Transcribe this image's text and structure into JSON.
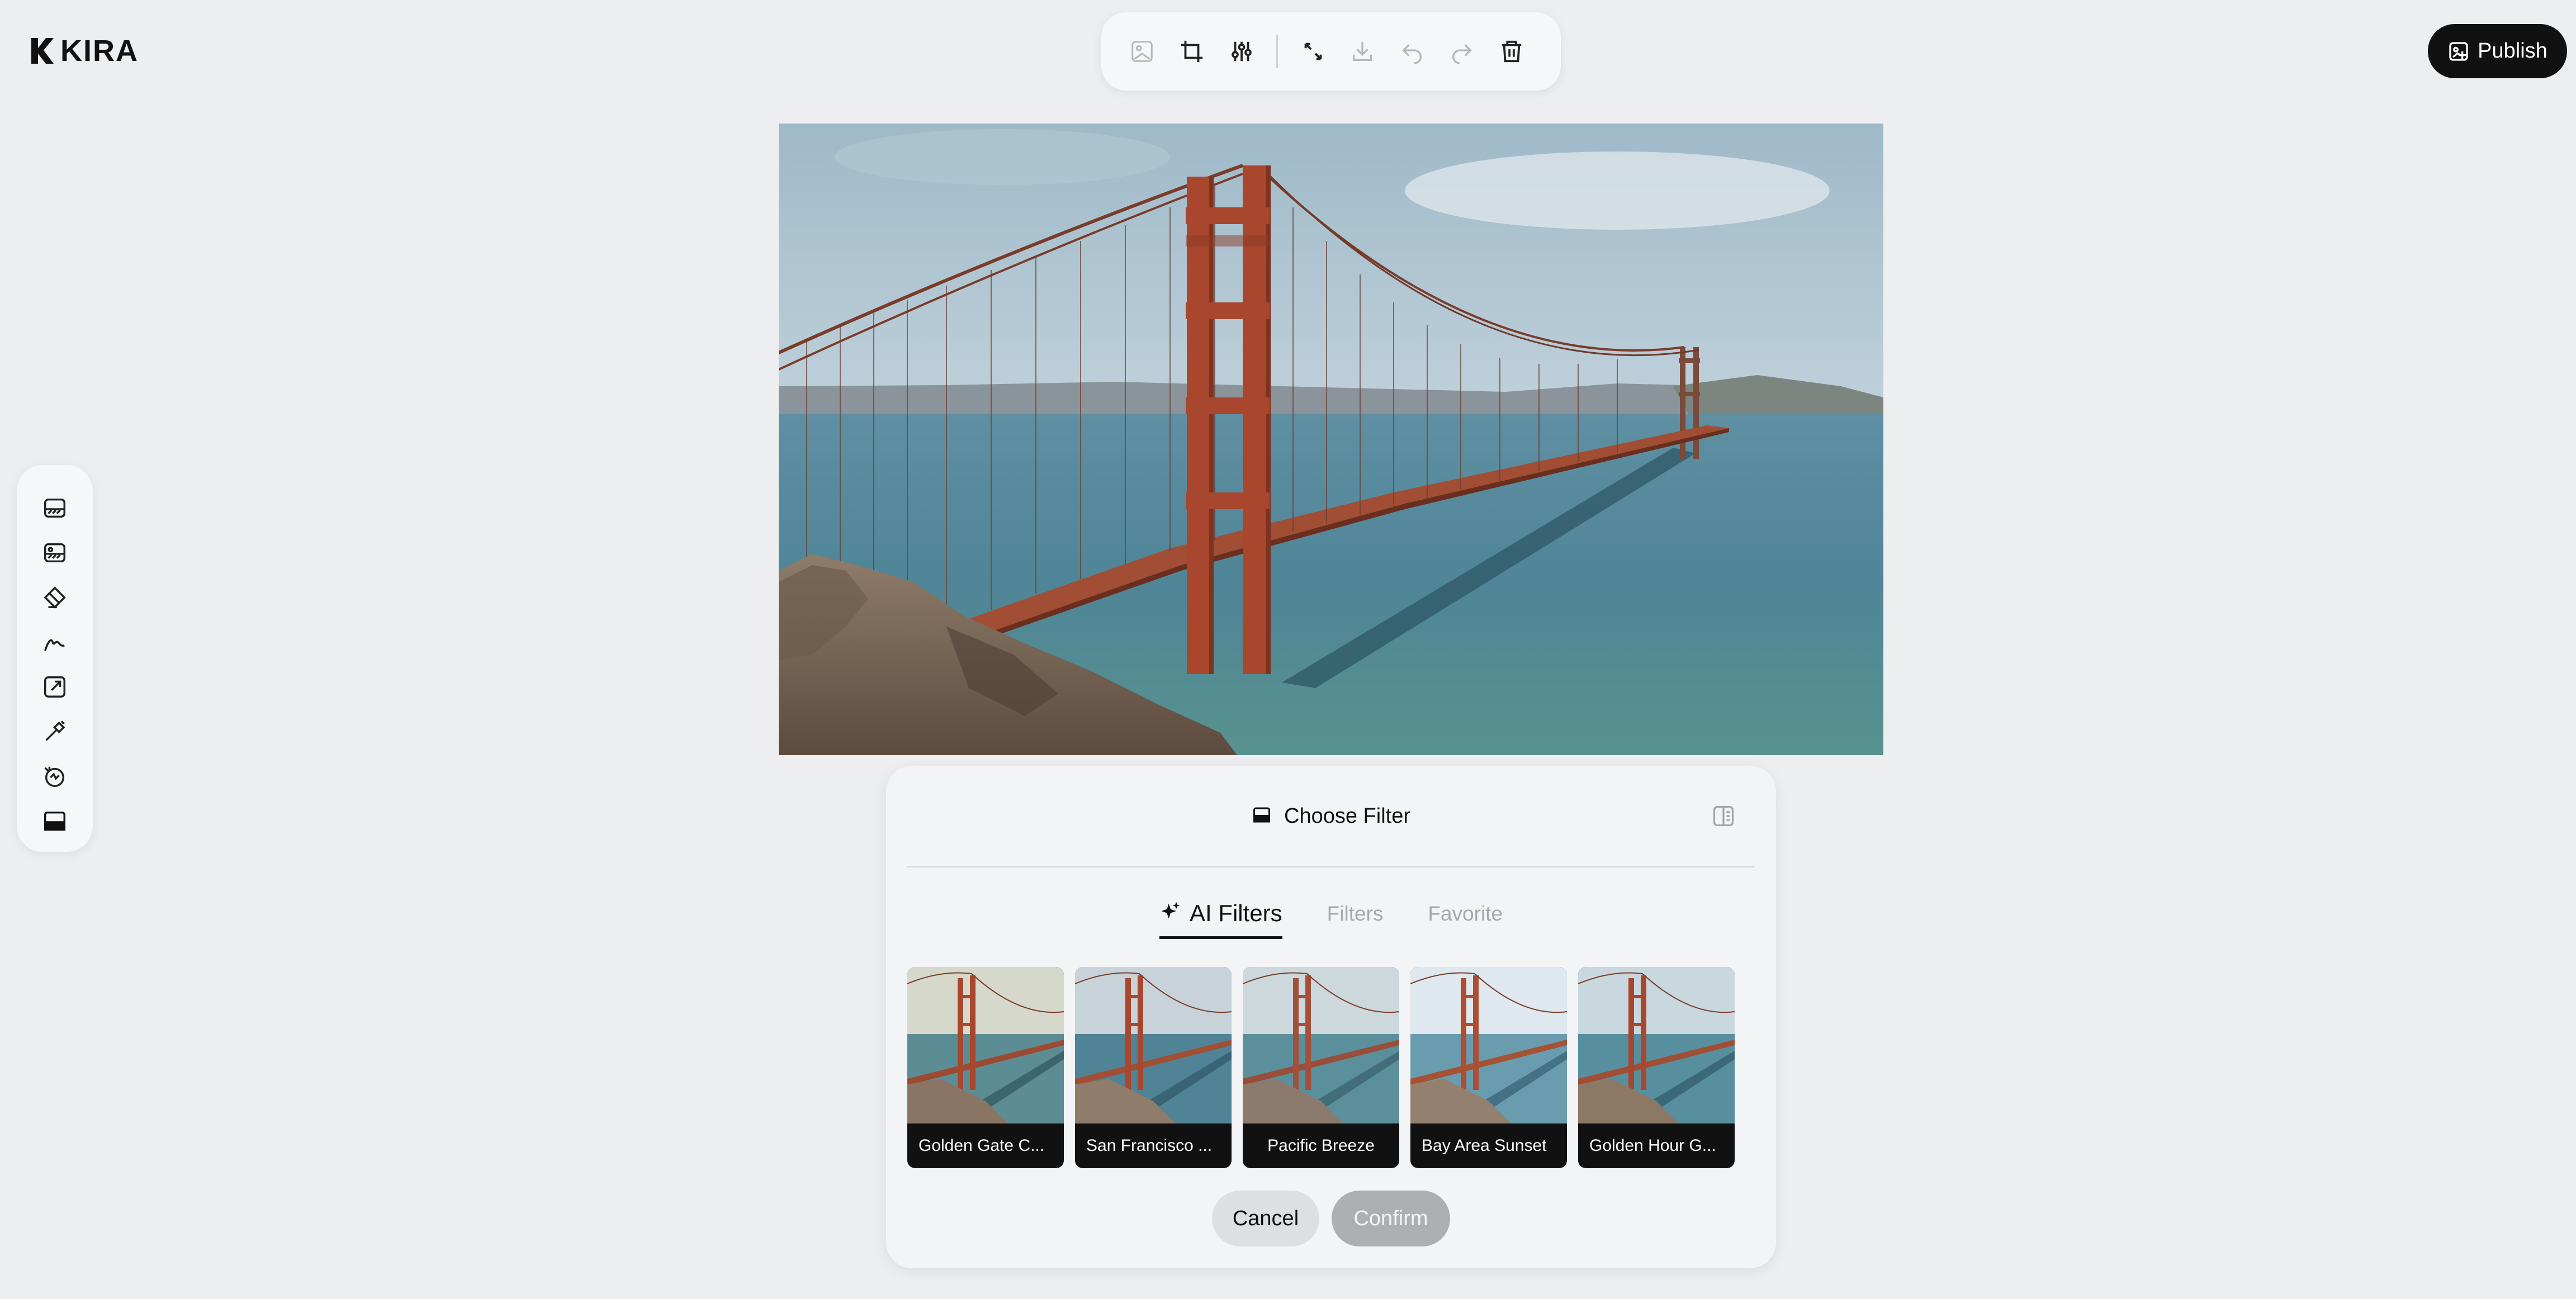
{
  "app": {
    "logo_text": "KIRA"
  },
  "top_toolbar": {
    "buttons": [
      {
        "icon": "image-icon",
        "enabled": false
      },
      {
        "icon": "crop-icon",
        "enabled": true
      },
      {
        "icon": "adjust-sliders-icon",
        "enabled": true
      },
      {
        "icon": "expand-icon",
        "enabled": true
      },
      {
        "icon": "download-icon",
        "enabled": false
      },
      {
        "icon": "undo-icon",
        "enabled": false
      },
      {
        "icon": "redo-icon",
        "enabled": false
      },
      {
        "icon": "trash-icon",
        "enabled": true
      }
    ]
  },
  "publish": {
    "label": "Publish"
  },
  "left_tools": {
    "items": [
      "background-layer-icon",
      "image-layer-icon",
      "eraser-icon",
      "draw-icon",
      "resize-icon",
      "magic-wand-icon",
      "retouch-icon",
      "filter-icon"
    ]
  },
  "filter_panel": {
    "title": "Choose Filter",
    "tabs": [
      {
        "label": "AI Filters",
        "active": true
      },
      {
        "label": "Filters",
        "active": false
      },
      {
        "label": "Favorite",
        "active": false
      }
    ],
    "filters": [
      {
        "label": "Golden Gate C..."
      },
      {
        "label": "San Francisco ..."
      },
      {
        "label": "Pacific Breeze"
      },
      {
        "label": "Bay Area Sunset"
      },
      {
        "label": "Golden Hour G..."
      }
    ],
    "cancel_label": "Cancel",
    "confirm_label": "Confirm"
  }
}
